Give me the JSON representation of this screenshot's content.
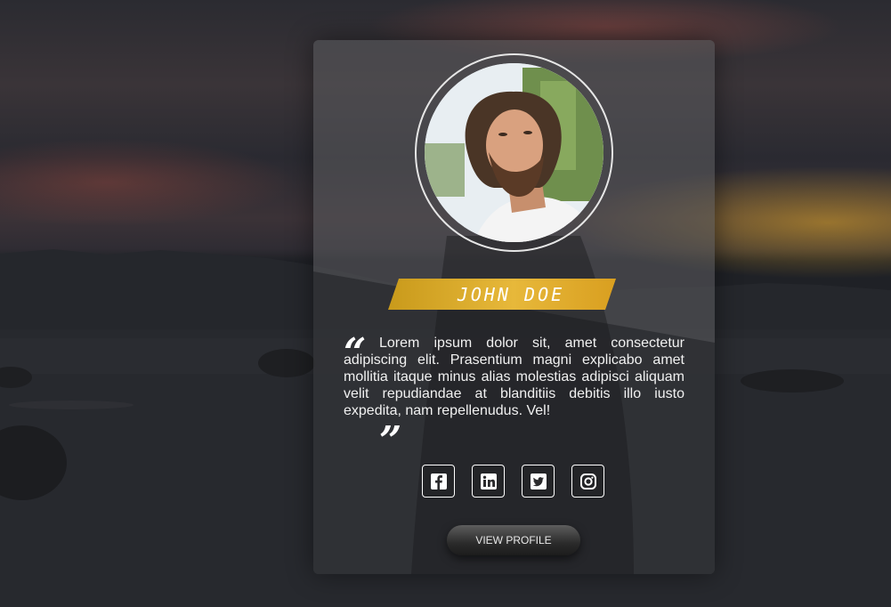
{
  "profile": {
    "name": "JOHN DOE",
    "quote": "Lorem ipsum dolor sit, amet consectetur adipiscing elit. Prasentium magni explicabo amet mollitia itaque minus alias molestias adipisci aliquam velit repudiandae at blanditiis debitis illo iusto expedita, nam repellenudus. Vel!",
    "quote_open": "“",
    "quote_close": "”",
    "button_label": "VIEW PROFILE"
  },
  "socials": [
    {
      "icon": "facebook-icon"
    },
    {
      "icon": "linkedin-icon"
    },
    {
      "icon": "twitter-icon"
    },
    {
      "icon": "instagram-icon"
    }
  ],
  "colors": {
    "accent": "#e0aa2a",
    "card": "rgba(255,255,255,0.10)",
    "text": "#f1f1f1"
  }
}
